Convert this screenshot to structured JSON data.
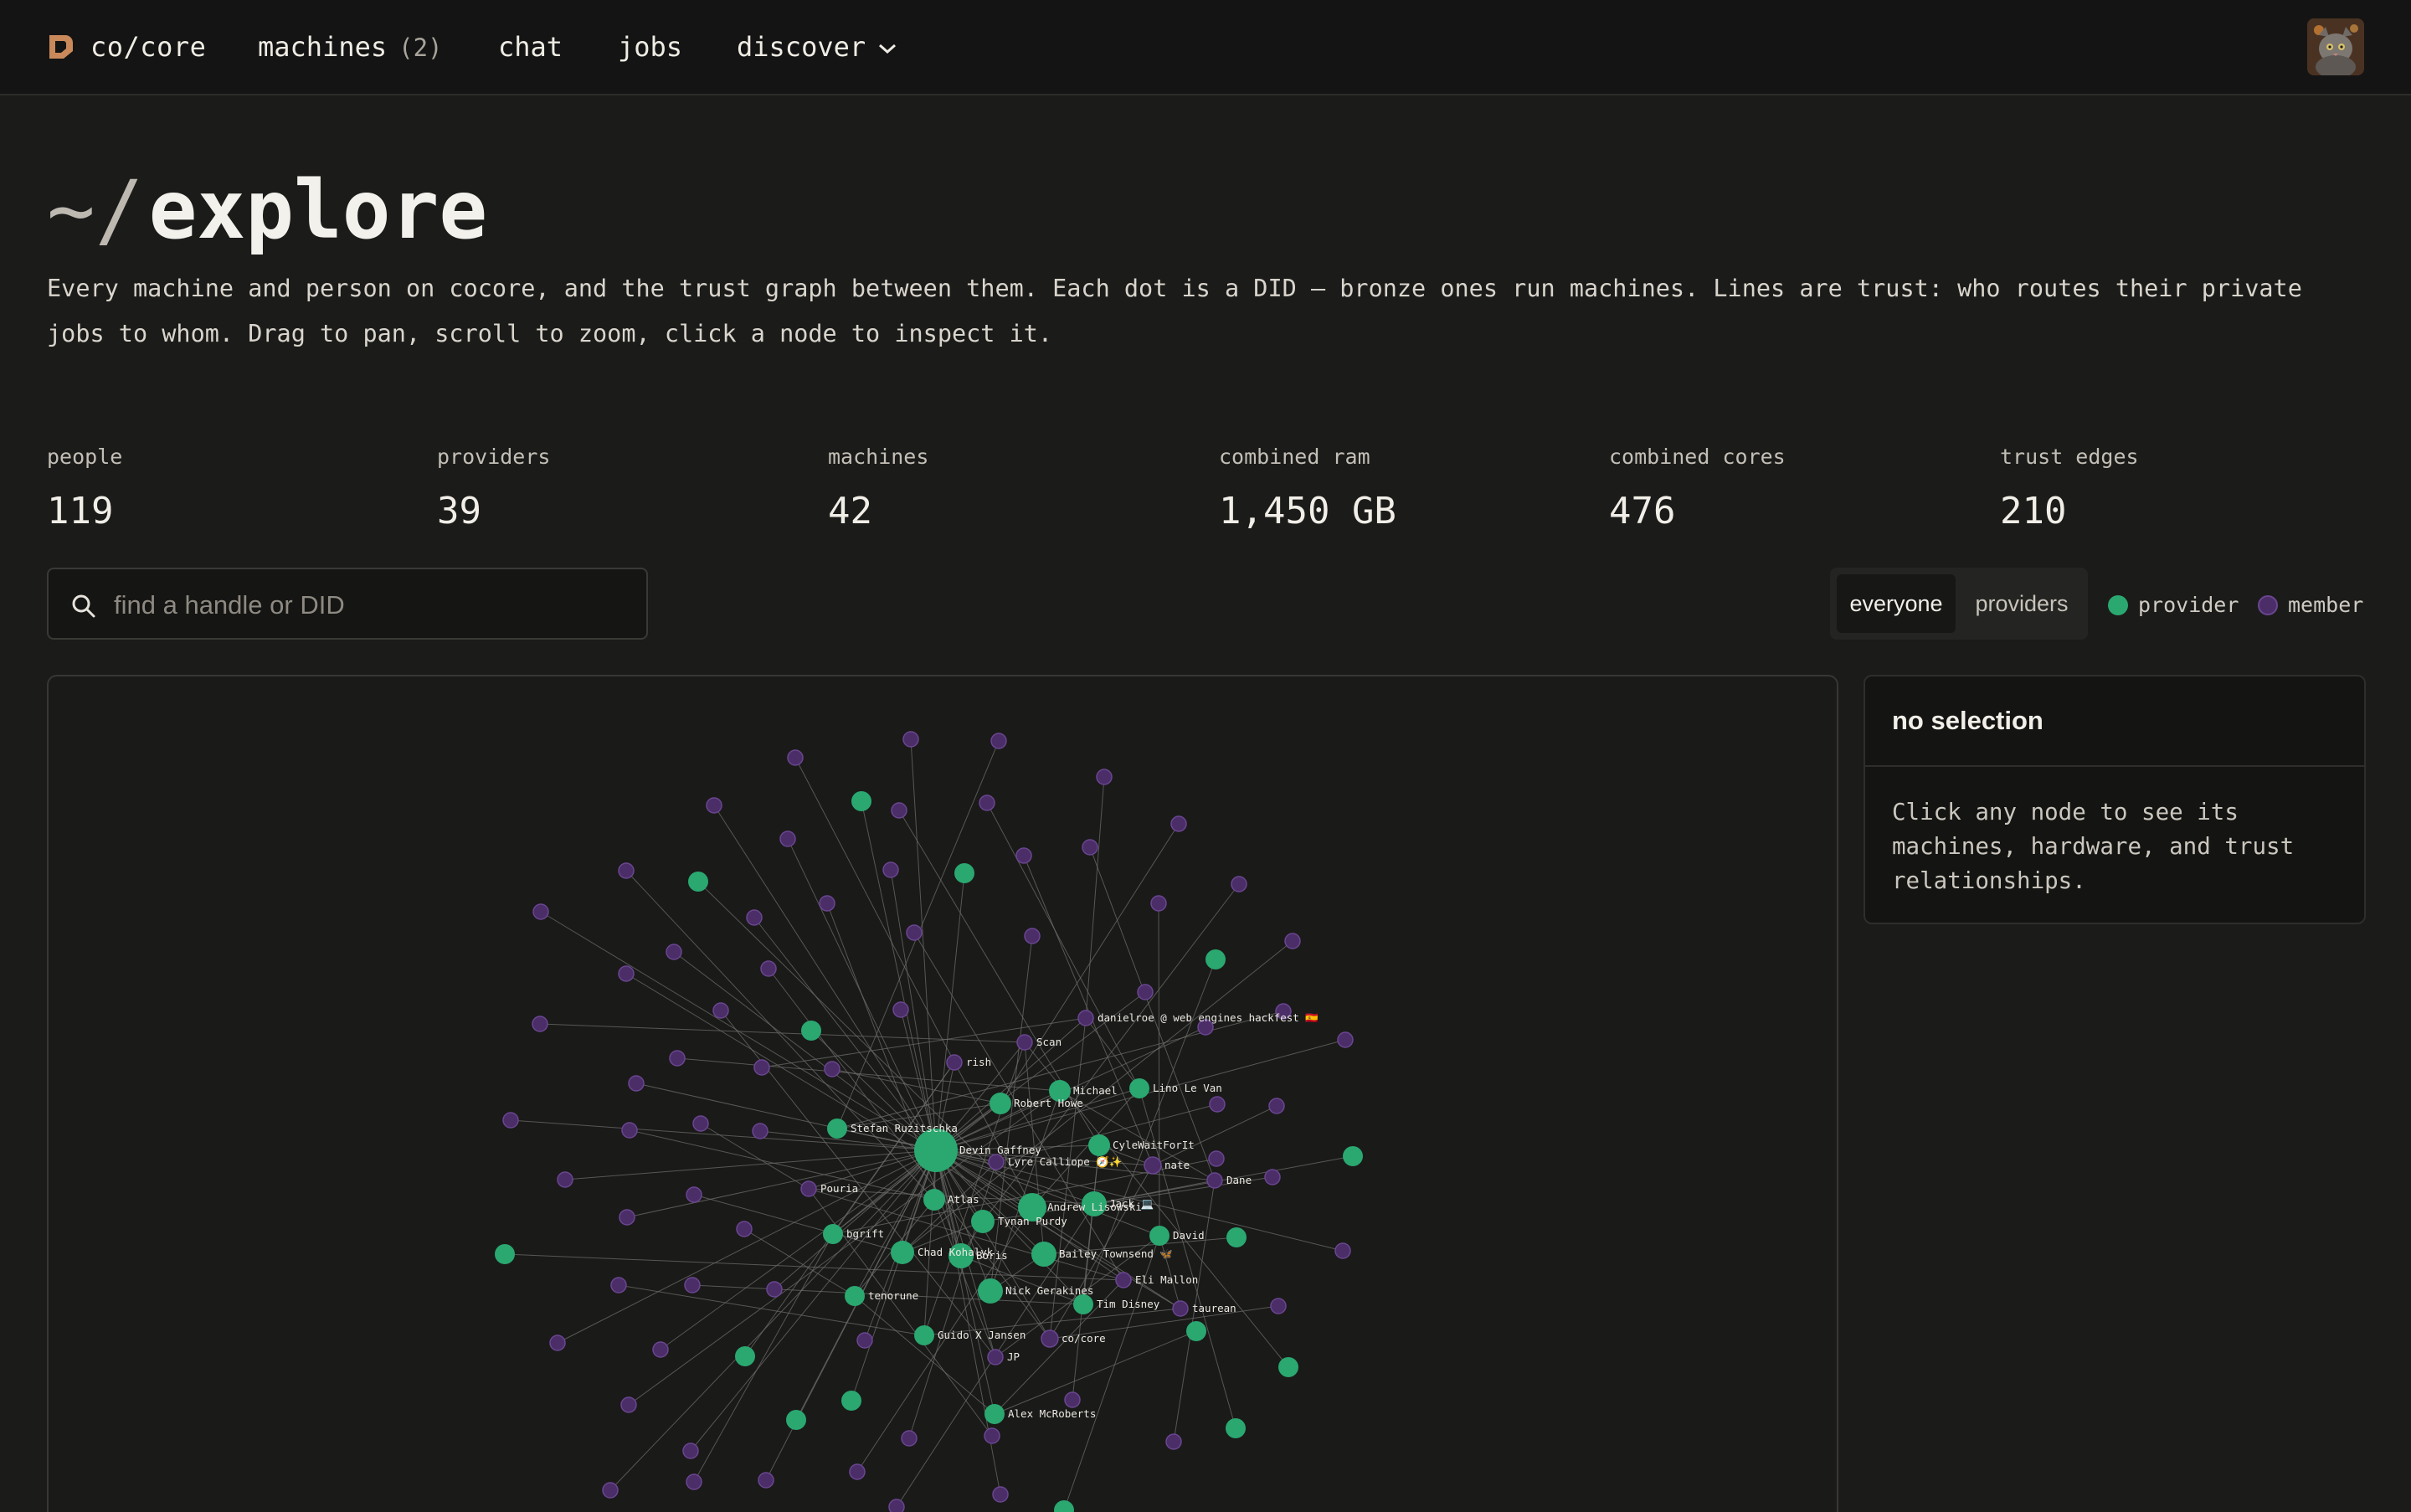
{
  "nav": {
    "brand": "co/core",
    "brand_icon": "cocore-logo-icon",
    "items": [
      {
        "label": "machines",
        "count": "(2)"
      },
      {
        "label": "chat"
      },
      {
        "label": "jobs"
      },
      {
        "label": "discover",
        "icon": "chevron-down-icon"
      }
    ]
  },
  "page": {
    "title_prefix": "~/",
    "title": "explore",
    "intro": "Every machine and person on cocore, and the trust graph between them. Each dot is a DID — bronze ones run machines. Lines are trust: who routes their private jobs to whom. Drag to pan, scroll to zoom, click a node to inspect it."
  },
  "stats": [
    {
      "label": "people",
      "value": "119"
    },
    {
      "label": "providers",
      "value": "39"
    },
    {
      "label": "machines",
      "value": "42"
    },
    {
      "label": "combined ram",
      "value": "1,450 GB"
    },
    {
      "label": "combined cores",
      "value": "476"
    },
    {
      "label": "trust edges",
      "value": "210"
    }
  ],
  "search": {
    "placeholder": "find a handle or DID",
    "value": ""
  },
  "filter": {
    "options": [
      "everyone",
      "providers"
    ],
    "selected": "everyone"
  },
  "legend": [
    {
      "label": "provider",
      "color": "#2aa870"
    },
    {
      "label": "member",
      "color": "#4b2d68"
    }
  ],
  "colors": {
    "provider": "#2aa870",
    "member": "#4b2d68",
    "member_stroke": "#6a4690",
    "edge": "#6c6c6a",
    "brand": "#c9895a"
  },
  "panel": {
    "title": "no selection",
    "body": "Click any node to see its machines, hardware, and trust relationships."
  },
  "graph": {
    "labels": [
      "Devin Gaffney",
      "Stefan Ruzitschka",
      "rish",
      "Scan",
      "danielroe @ web engines hackfest 🇪🇸",
      "Lino Le Van",
      "Michael",
      "Robert Howe",
      "CyleWaitForIt",
      "Lyre Calliope 🧭✨",
      "nate",
      "Dane",
      "Pouria",
      "Atlas",
      "Andrew Lisowski",
      "Jack 💻",
      "Tynan Purdy",
      "David",
      "bgrift",
      "Chad Kohalyk",
      "Boris",
      "Bailey Townsend 🦋",
      "Eli Mallon",
      "Nick Gerakines",
      "tenorune",
      "Tim Disney",
      "taurean",
      "Guido X Jansen",
      "co/core",
      "JP",
      "Alex McRoberts"
    ]
  }
}
